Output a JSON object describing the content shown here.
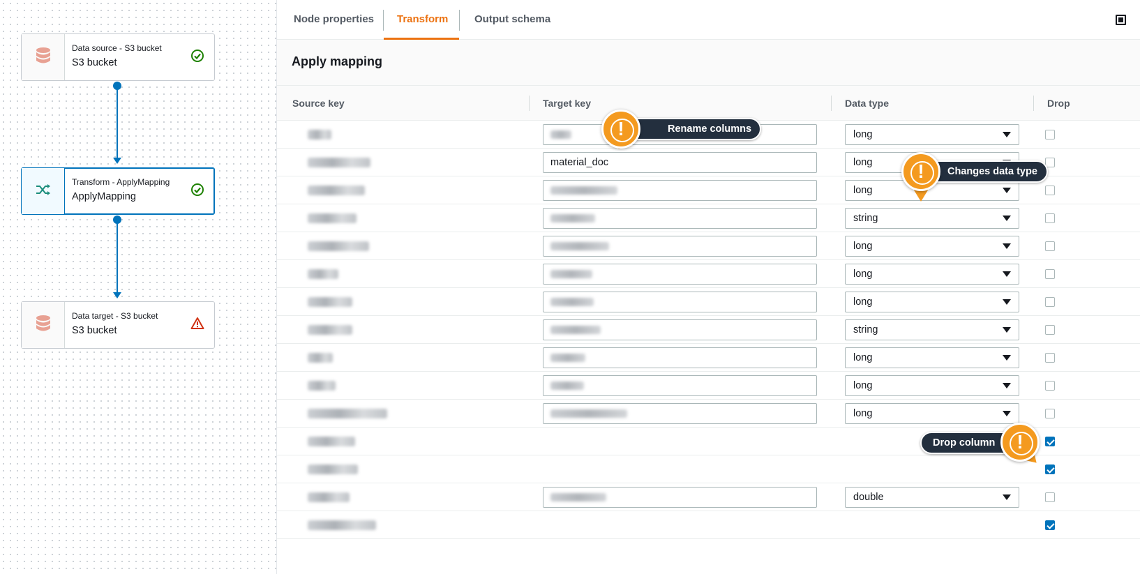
{
  "canvas": {
    "nodes": [
      {
        "subtitle": "Data source - S3 bucket",
        "title": "S3 bucket",
        "status": "success"
      },
      {
        "subtitle": "Transform - ApplyMapping",
        "title": "ApplyMapping",
        "status": "success"
      },
      {
        "subtitle": "Data target - S3 bucket",
        "title": "S3 bucket",
        "status": "warning"
      }
    ],
    "colors": {
      "edge": "#0073bb",
      "success": "#1d8102",
      "warning": "#d13212",
      "db_icon": "#e8a193",
      "transform_icon": "#1a8d7c"
    }
  },
  "tabs": [
    {
      "label": "Node properties",
      "active": false
    },
    {
      "label": "Transform",
      "active": true
    },
    {
      "label": "Output schema",
      "active": false
    }
  ],
  "section_title": "Apply mapping",
  "table": {
    "headers": {
      "source_key": "Source key",
      "target_key": "Target key",
      "data_type": "Data type",
      "drop": "Drop"
    },
    "rows": [
      {
        "target_value": "",
        "data_type": "long",
        "drop": false
      },
      {
        "target_value": "material_doc",
        "data_type": "long",
        "drop": false
      },
      {
        "target_value": "",
        "data_type": "long",
        "drop": false
      },
      {
        "target_value": "",
        "data_type": "string",
        "drop": false
      },
      {
        "target_value": "",
        "data_type": "long",
        "drop": false
      },
      {
        "target_value": "",
        "data_type": "long",
        "drop": false
      },
      {
        "target_value": "",
        "data_type": "long",
        "drop": false
      },
      {
        "target_value": "",
        "data_type": "string",
        "drop": false
      },
      {
        "target_value": "",
        "data_type": "long",
        "drop": false
      },
      {
        "target_value": "",
        "data_type": "long",
        "drop": false
      },
      {
        "target_value": "",
        "data_type": "long",
        "drop": false
      },
      {
        "target_value": "",
        "data_type": "",
        "drop": true
      },
      {
        "target_value": "",
        "data_type": "",
        "drop": true
      },
      {
        "target_value": "",
        "data_type": "double",
        "drop": false
      },
      {
        "target_value": "",
        "data_type": "",
        "drop": true
      }
    ]
  },
  "callouts": {
    "rename": "Rename columns",
    "datatype": "Changes data type",
    "drop": "Drop column",
    "badge_glyph": "!"
  },
  "accent_color": "#ec7211"
}
